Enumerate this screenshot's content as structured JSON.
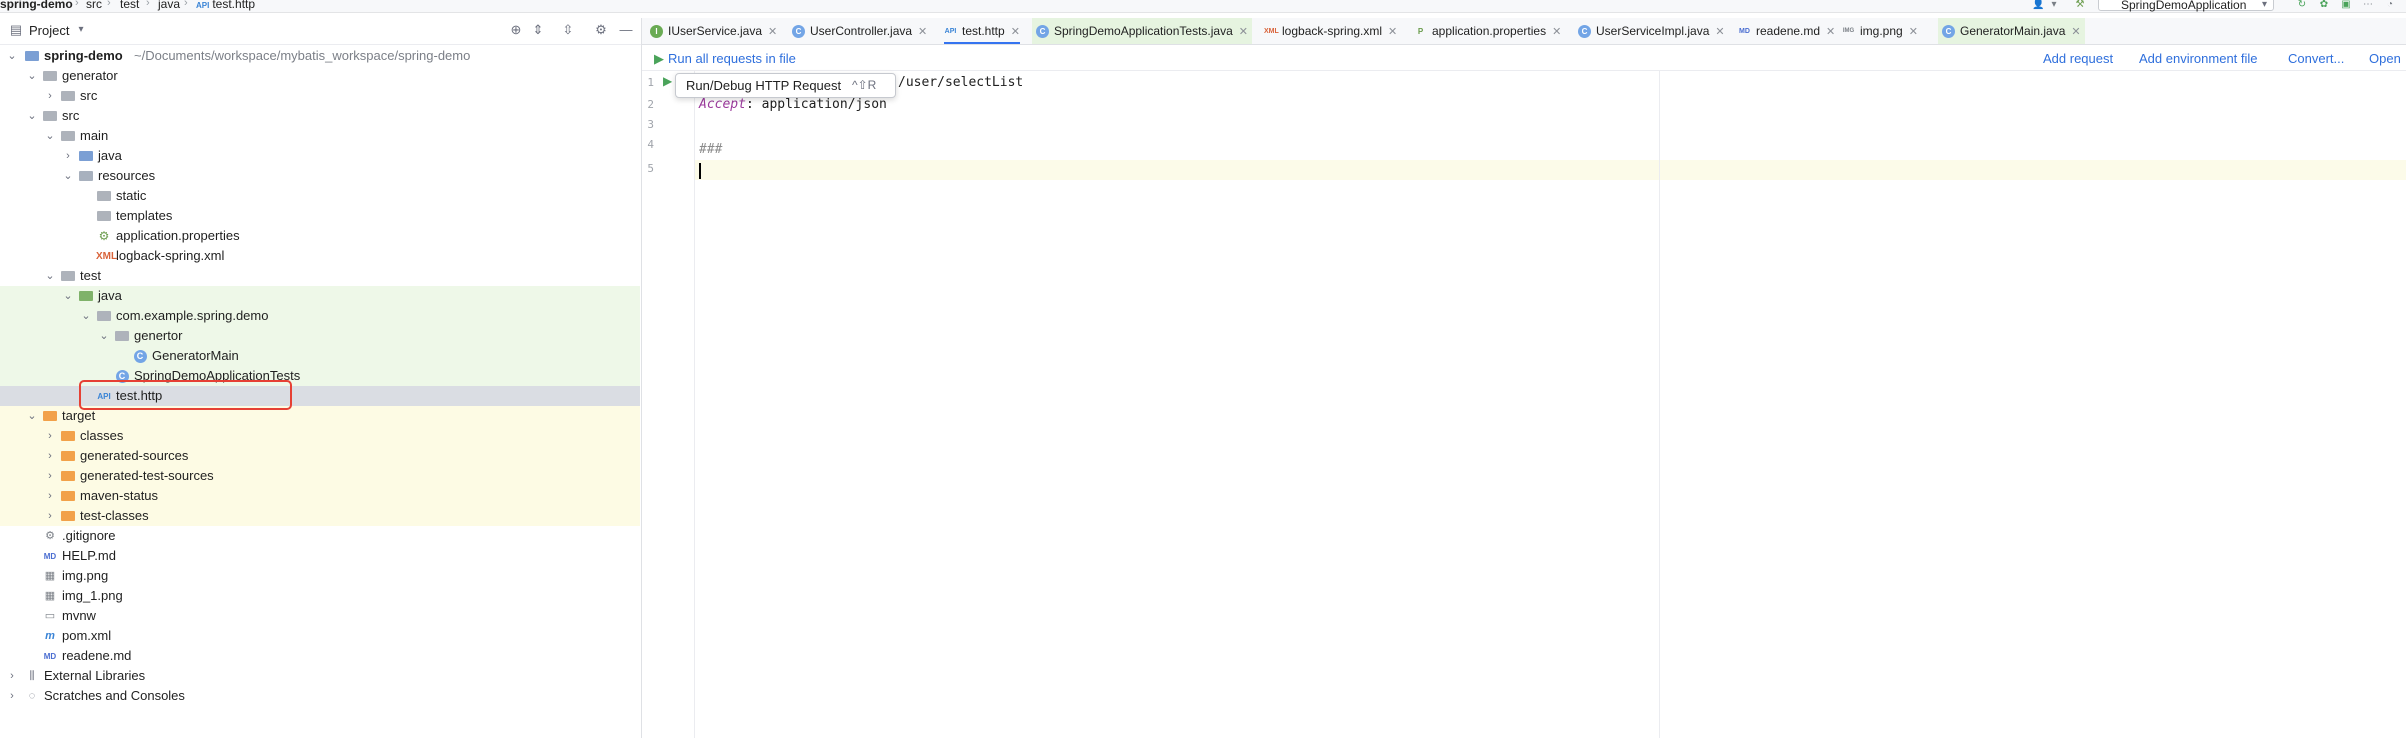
{
  "breadcrumb": [
    "spring-demo",
    "src",
    "test",
    "java",
    "test.http"
  ],
  "run_config": {
    "label": "SpringDemoApplication"
  },
  "project_panel": {
    "title": "Project"
  },
  "tree": [
    {
      "label": "spring-demo",
      "path": "~/Documents/workspace/mybatis_workspace/spring-demo",
      "bold": true
    },
    {
      "label": "generator"
    },
    {
      "label": "src"
    },
    {
      "label": "src"
    },
    {
      "label": "main"
    },
    {
      "label": "java"
    },
    {
      "label": "resources"
    },
    {
      "label": "static"
    },
    {
      "label": "templates"
    },
    {
      "label": "application.properties"
    },
    {
      "label": "logback-spring.xml"
    },
    {
      "label": "test"
    },
    {
      "label": "java"
    },
    {
      "label": "com.example.spring.demo"
    },
    {
      "label": "genertor"
    },
    {
      "label": "GeneratorMain"
    },
    {
      "label": "SpringDemoApplicationTests"
    },
    {
      "label": "test.http"
    },
    {
      "label": "target"
    },
    {
      "label": "classes"
    },
    {
      "label": "generated-sources"
    },
    {
      "label": "generated-test-sources"
    },
    {
      "label": "maven-status"
    },
    {
      "label": "test-classes"
    },
    {
      "label": ".gitignore"
    },
    {
      "label": "HELP.md"
    },
    {
      "label": "img.png"
    },
    {
      "label": "img_1.png"
    },
    {
      "label": "mvnw"
    },
    {
      "label": "pom.xml"
    },
    {
      "label": "readene.md"
    },
    {
      "label": "External Libraries"
    },
    {
      "label": "Scratches and Consoles"
    }
  ],
  "tabs": [
    {
      "label": "IUserService.java",
      "icon": "I"
    },
    {
      "label": "UserController.java",
      "icon": "C"
    },
    {
      "label": "test.http",
      "icon": "API"
    },
    {
      "label": "SpringDemoApplicationTests.java",
      "icon": "C"
    },
    {
      "label": "logback-spring.xml",
      "icon": "XML"
    },
    {
      "label": "application.properties",
      "icon": "P"
    },
    {
      "label": "UserServiceImpl.java",
      "icon": "C"
    },
    {
      "label": "readene.md",
      "icon": "MD"
    },
    {
      "label": "img.png",
      "icon": "IMG"
    },
    {
      "label": "GeneratorMain.java",
      "icon": "C"
    }
  ],
  "toolbar": {
    "run_all": "Run all requests in file",
    "add_request": "Add request",
    "add_env": "Add environment file",
    "convert": "Convert...",
    "open": "Open"
  },
  "editor": {
    "line_numbers": [
      "1",
      "2",
      "3",
      "4",
      "5"
    ],
    "line1_rest": "/user/selectList",
    "line2_key": "Accept",
    "line2_value": ": application/json",
    "line4": "###"
  },
  "tooltip": {
    "label": "Run/Debug HTTP Request",
    "shortcut": "^⇧R"
  },
  "colors": {
    "accent": "#3574f0",
    "highlight_box": "#e64034",
    "test_bg": "#eef8e8",
    "target_bg": "#fdfbe4",
    "selected_bg": "#dadde3"
  }
}
